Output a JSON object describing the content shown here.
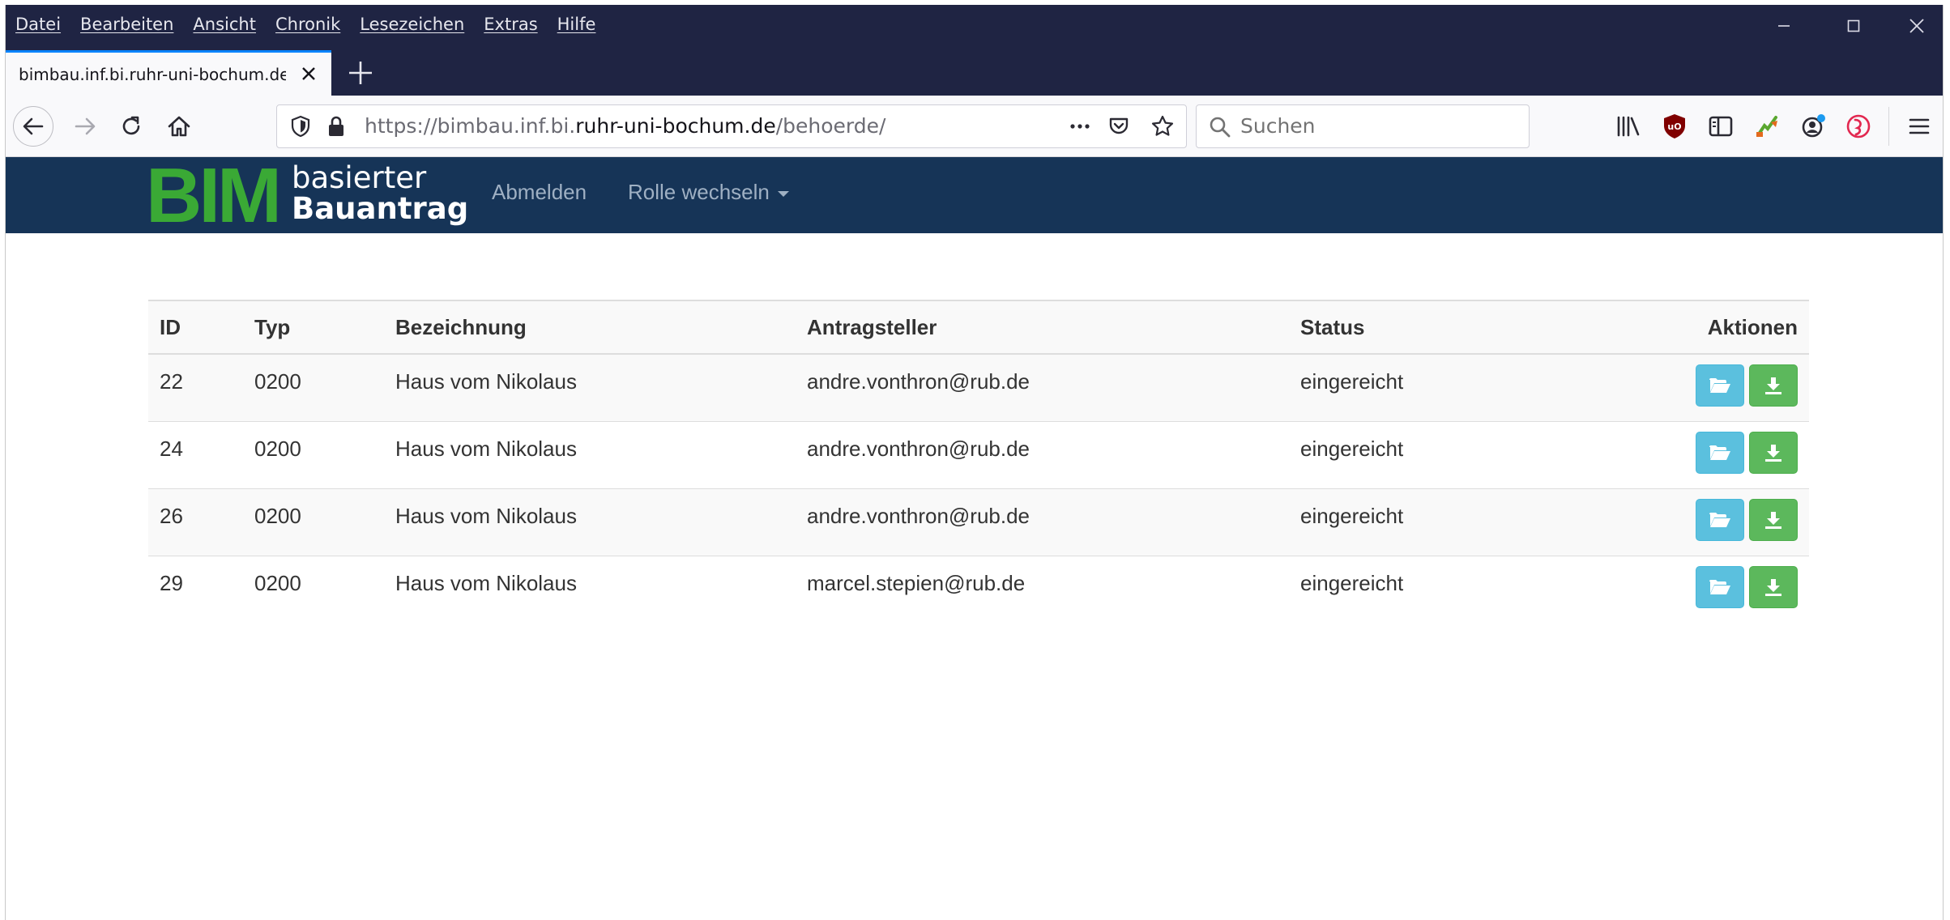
{
  "browser": {
    "menu": [
      "Datei",
      "Bearbeiten",
      "Ansicht",
      "Chronik",
      "Lesezeichen",
      "Extras",
      "Hilfe"
    ],
    "tab_title": "bimbau.inf.bi.ruhr-uni-bochum.de/behoerde/",
    "url": {
      "prefix": "https://bimbau.inf.bi.",
      "host": "ruhr-uni-bochum.de",
      "path": "/behoerde/"
    },
    "search_placeholder": "Suchen",
    "icons": [
      "back-arrow-icon",
      "forward-arrow-icon",
      "reload-icon",
      "home-icon",
      "shield-icon",
      "lock-icon",
      "more-dots-icon",
      "pocket-icon",
      "star-icon",
      "search-icon",
      "library-icon",
      "ublock-icon",
      "sidebar-icon",
      "extension-icon",
      "account-icon",
      "reader-icon",
      "hamburger-menu-icon"
    ],
    "accent": "#0a84ff",
    "titlebar_color": "#1f2443"
  },
  "site": {
    "logo_big": "BIM",
    "logo_line1": "basierter",
    "logo_line2": "Bauantrag",
    "nav": {
      "logout": "Abmelden",
      "switch_role": "Rolle wechseln"
    },
    "colors": {
      "navbar": "#163457",
      "logo_green": "#3aa935",
      "btn_info": "#5bc0de",
      "btn_success": "#5cb85c"
    }
  },
  "table": {
    "headers": {
      "id": "ID",
      "typ": "Typ",
      "bezeichnung": "Bezeichnung",
      "antragsteller": "Antragsteller",
      "status": "Status",
      "aktionen": "Aktionen"
    },
    "rows": [
      {
        "id": "22",
        "typ": "0200",
        "bezeichnung": "Haus vom Nikolaus",
        "antragsteller": "andre.vonthron@rub.de",
        "status": "eingereicht"
      },
      {
        "id": "24",
        "typ": "0200",
        "bezeichnung": "Haus vom Nikolaus",
        "antragsteller": "andre.vonthron@rub.de",
        "status": "eingereicht"
      },
      {
        "id": "26",
        "typ": "0200",
        "bezeichnung": "Haus vom Nikolaus",
        "antragsteller": "andre.vonthron@rub.de",
        "status": "eingereicht"
      },
      {
        "id": "29",
        "typ": "0200",
        "bezeichnung": "Haus vom Nikolaus",
        "antragsteller": "marcel.stepien@rub.de",
        "status": "eingereicht"
      }
    ]
  }
}
